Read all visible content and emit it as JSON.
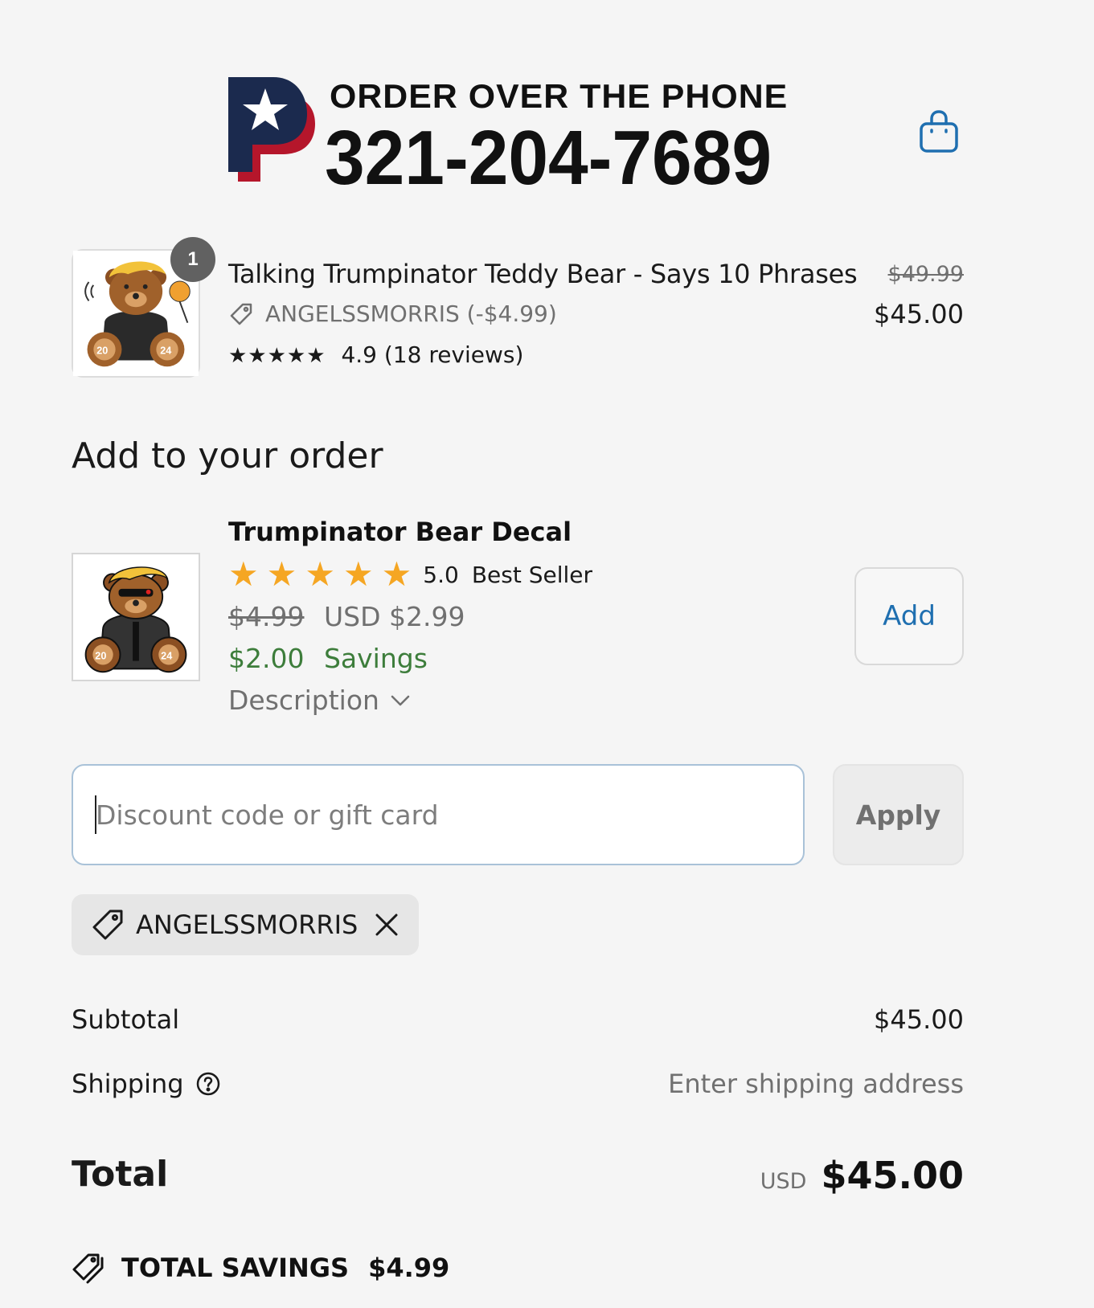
{
  "header": {
    "logo_line1": "ORDER OVER THE PHONE",
    "logo_line2": "321-204-7689",
    "cart_icon": "shopping-bag-icon",
    "accent_color": "#1f6fb0"
  },
  "order_item": {
    "title": "Talking Trumpinator Teddy Bear - Says 10 Phrases",
    "quantity": "1",
    "discount_label": "ANGELSSMORRIS (-$4.99)",
    "stars": "★★★★★",
    "rating_text": "4.9 (18 reviews)",
    "original_price": "$49.99",
    "price": "$45.00"
  },
  "upsell": {
    "section_title": "Add to your order",
    "name": "Trumpinator Bear Decal",
    "star_count": 5,
    "star_color": "#f5a623",
    "score": "5.0",
    "badge": "Best Seller",
    "original_price": "$4.99",
    "price": "USD $2.99",
    "savings_amount": "$2.00",
    "savings_label": "Savings",
    "savings_color": "#3d7d3b",
    "description_label": "Description",
    "add_label": "Add"
  },
  "discount": {
    "placeholder": "Discount code or gift card",
    "value": "",
    "apply_label": "Apply",
    "applied_code": "ANGELSSMORRIS"
  },
  "totals": {
    "subtotal_label": "Subtotal",
    "subtotal_value": "$45.00",
    "shipping_label": "Shipping",
    "shipping_value": "Enter shipping address",
    "total_label": "Total",
    "total_currency": "USD",
    "total_value": "$45.00",
    "savings_label": "TOTAL SAVINGS",
    "savings_value": "$4.99"
  }
}
